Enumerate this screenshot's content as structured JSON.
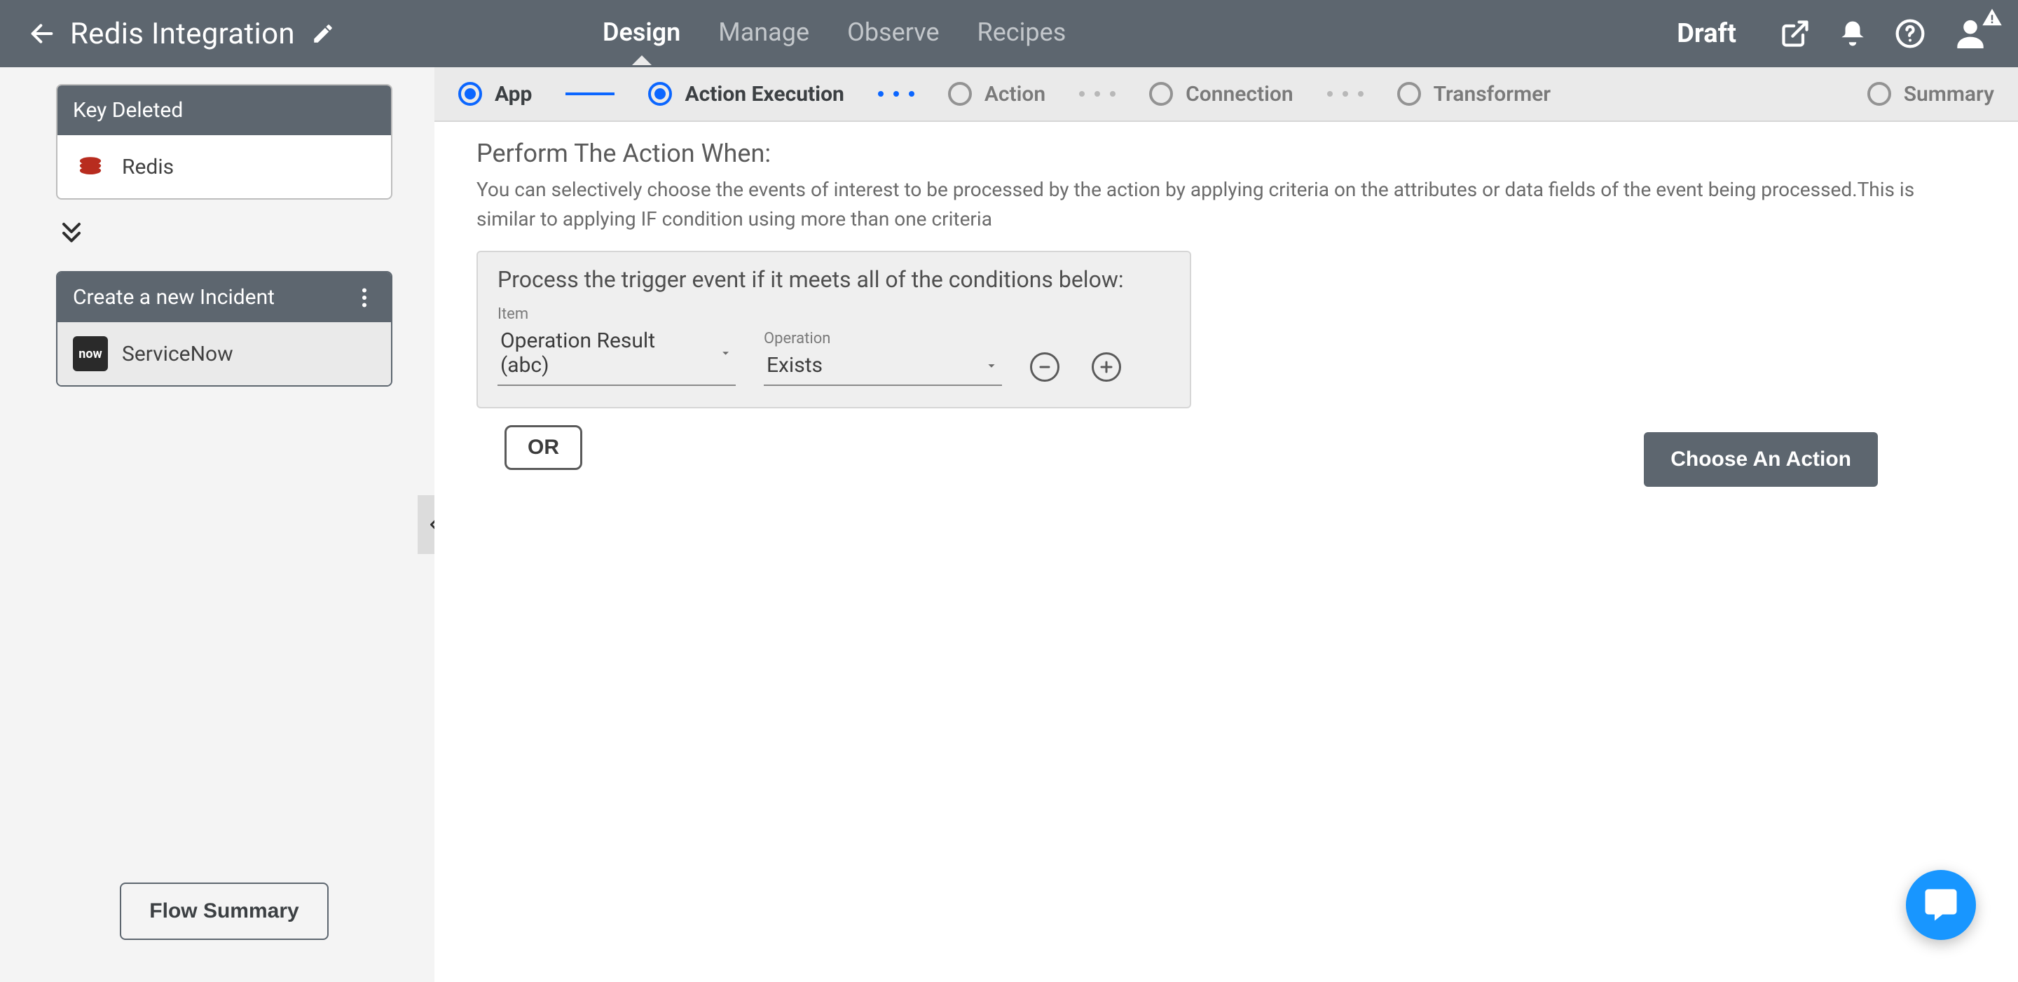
{
  "header": {
    "title": "Redis Integration",
    "nav": {
      "design": "Design",
      "manage": "Manage",
      "observe": "Observe",
      "recipes": "Recipes"
    },
    "status": "Draft"
  },
  "sidebar": {
    "trigger_card": {
      "title": "Key Deleted",
      "app": "Redis"
    },
    "action_card": {
      "title": "Create a new Incident",
      "app": "ServiceNow",
      "chip": "now"
    },
    "flow_summary_label": "Flow Summary"
  },
  "stepper": {
    "app": "App",
    "action_execution": "Action Execution",
    "action": "Action",
    "connection": "Connection",
    "transformer": "Transformer",
    "summary": "Summary"
  },
  "panel": {
    "heading": "Perform The Action When:",
    "helper": "You can selectively choose the events of interest to be processed by the action by applying criteria on the attributes or data fields of the event being processed.This is similar to applying IF condition using more than one criteria",
    "cond_title": "Process the trigger event if it meets all of the conditions below:",
    "item_label": "Item",
    "operation_label": "Operation",
    "item_value": "Operation Result (abc)",
    "operation_value": "Exists",
    "or_label": "OR",
    "choose_action_label": "Choose An Action"
  }
}
